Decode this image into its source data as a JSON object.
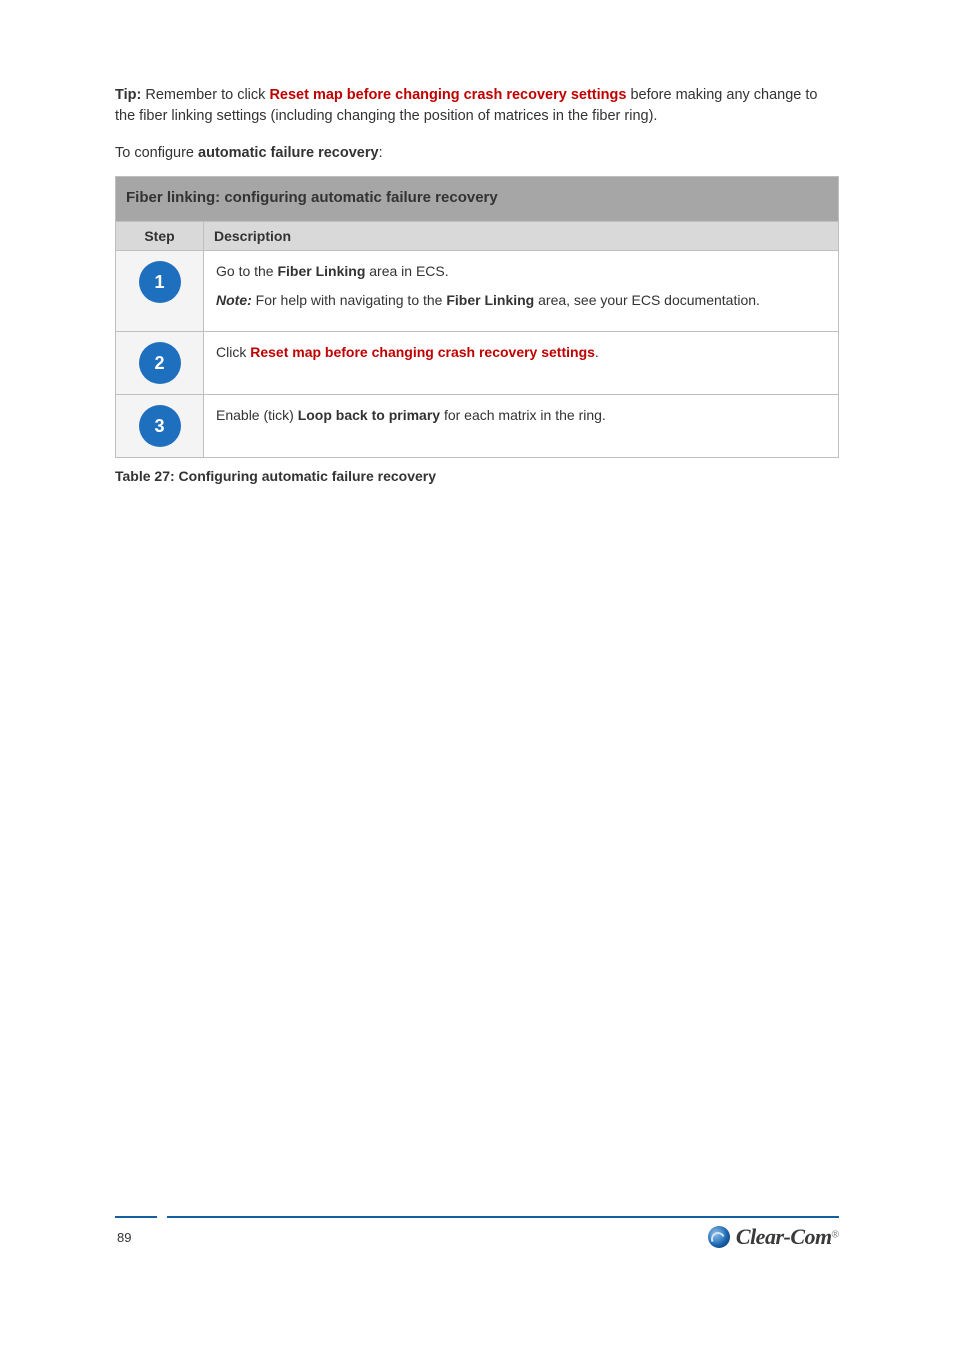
{
  "intro": {
    "label": "Tip:",
    "text_before": " Remember to click ",
    "red": "Reset map before changing crash recovery settings",
    "text_after": " before making any change to the fiber linking settings (including changing the position of matrices in the fiber ring)."
  },
  "intro2": {
    "prefix": "To configure ",
    "label": "automatic failure recovery",
    "suffix": ":"
  },
  "table": {
    "title": "Fiber linking: configuring automatic failure recovery",
    "headers": {
      "step": "Step",
      "desc": "Description"
    },
    "rows": [
      {
        "num": "1",
        "p1_before": "Go to the ",
        "p1_bold": "Fiber Linking",
        "p1_after": " area in ECS.",
        "note_label": "Note:",
        "note_before": " For help with navigating to the ",
        "note_bold": "Fiber Linking",
        "note_after": " area, see your ECS documentation."
      },
      {
        "num": "2",
        "p_before": "Click ",
        "p_red": "Reset map before changing crash recovery settings",
        "p_after": "."
      },
      {
        "num": "3",
        "p_before": "Enable (tick) ",
        "p_bold": "Loop back to primary",
        "p_after": " for each matrix in the ring."
      }
    ],
    "caption": "Table 27: Configuring automatic failure recovery"
  },
  "footer": {
    "page": "89",
    "brand": "Clear-Com",
    "reg": "®"
  }
}
